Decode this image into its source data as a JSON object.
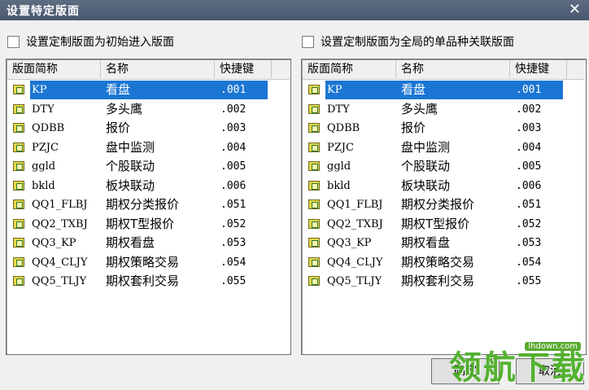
{
  "window": {
    "title": "设置特定版面",
    "close_glyph": "✕"
  },
  "left": {
    "checkbox_label": "设置定制版面为初始进入版面",
    "checked": false
  },
  "right": {
    "checkbox_label": "设置定制版面为全局的单品种关联版面",
    "checked": false
  },
  "columns": {
    "abbr": "版面简称",
    "name": "名称",
    "key": "快捷键"
  },
  "rows": [
    {
      "abbr": "KP",
      "name": "看盘",
      "key": ".001"
    },
    {
      "abbr": "DTY",
      "name": "多头鹰",
      "key": ".002"
    },
    {
      "abbr": "QDBB",
      "name": "报价",
      "key": ".003"
    },
    {
      "abbr": "PZJC",
      "name": "盘中监测",
      "key": ".004"
    },
    {
      "abbr": "ggld",
      "name": "个股联动",
      "key": ".005"
    },
    {
      "abbr": "bkld",
      "name": "板块联动",
      "key": ".006"
    },
    {
      "abbr": "QQ1_FLBJ",
      "name": "期权分类报价",
      "key": ".051"
    },
    {
      "abbr": "QQ2_TXBJ",
      "name": "期权T型报价",
      "key": ".052"
    },
    {
      "abbr": "QQ3_KP",
      "name": "期权看盘",
      "key": ".053"
    },
    {
      "abbr": "QQ4_CLJY",
      "name": "期权策略交易",
      "key": ".054"
    },
    {
      "abbr": "QQ5_TLJY",
      "name": "期权套利交易",
      "key": ".055"
    }
  ],
  "selected_index": 0,
  "buttons": {
    "ok": "确定",
    "cancel": "取消"
  },
  "watermark": {
    "text": "领航下载",
    "url": "lhdown.com"
  },
  "colors": {
    "selection": "#1b76d3",
    "titlebar": "#55637a"
  }
}
